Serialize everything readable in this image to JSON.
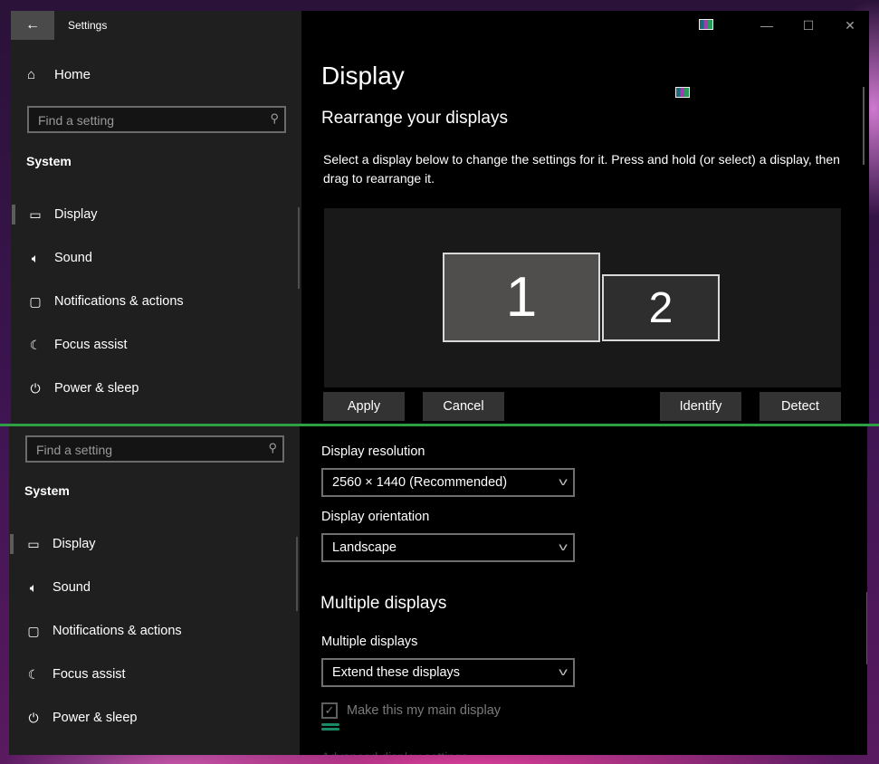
{
  "window": {
    "app_title": "Settings",
    "back_icon": "arrow-left-icon",
    "caption_buttons": {
      "minimize": "—",
      "maximize": "☐",
      "close": "✕"
    }
  },
  "sidebar": {
    "home_label": "Home",
    "search_placeholder": "Find a setting",
    "section_title": "System",
    "items": [
      {
        "label": "Display",
        "icon": "monitor-icon",
        "selected": true
      },
      {
        "label": "Sound",
        "icon": "speaker-icon",
        "selected": false
      },
      {
        "label": "Notifications & actions",
        "icon": "message-icon",
        "selected": false
      },
      {
        "label": "Focus assist",
        "icon": "moon-icon",
        "selected": false
      },
      {
        "label": "Power & sleep",
        "icon": "power-icon",
        "selected": false
      }
    ]
  },
  "main": {
    "page_title": "Display",
    "rearrange_title": "Rearrange your displays",
    "rearrange_desc": "Select a display below to change the settings for it. Press and hold (or select) a display, then drag to rearrange it.",
    "monitors": [
      {
        "number": "1",
        "selected": true
      },
      {
        "number": "2",
        "selected": false
      }
    ],
    "buttons": {
      "apply": "Apply",
      "cancel": "Cancel",
      "identify": "Identify",
      "detect": "Detect"
    },
    "resolution": {
      "label": "Display resolution",
      "value": "2560 × 1440 (Recommended)"
    },
    "orientation": {
      "label": "Display orientation",
      "value": "Landscape"
    },
    "multiple_title": "Multiple displays",
    "multiple": {
      "label": "Multiple displays",
      "value": "Extend these displays"
    },
    "main_display_checkbox": {
      "label": "Make this my main display",
      "checked": true,
      "disabled": true
    },
    "cut_off_text": "Advanced display settings"
  },
  "colors": {
    "seam": "#2ea043",
    "sidebar_bg": "#1f1f1f",
    "main_bg": "#000000",
    "button_bg": "#333333"
  }
}
